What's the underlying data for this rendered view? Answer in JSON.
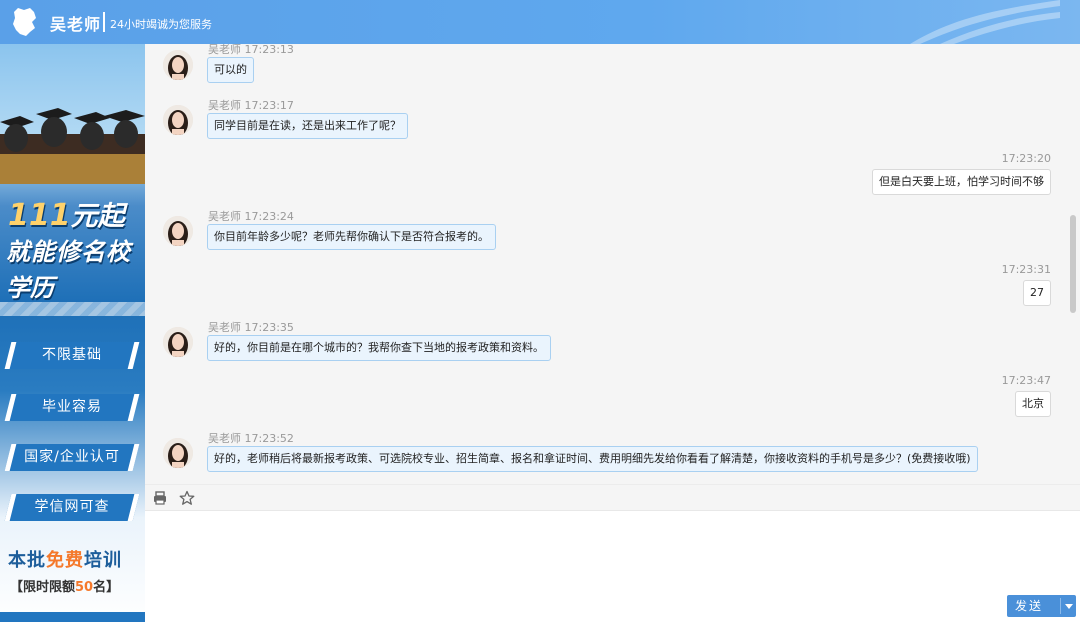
{
  "header": {
    "name": "吴老师",
    "slogan": "24小时竭诚为您服务",
    "color": "#5aa0e8"
  },
  "banner": {
    "price_num": "111",
    "price_suffix": "元起",
    "line2": "就能修名校",
    "line3": "学历",
    "tags": [
      "不限基础",
      "毕业容易",
      "国家/企业认可",
      "学信网可查"
    ],
    "free_a": "本批",
    "free_hl": "免费",
    "free_b": "培训",
    "limit_a": "【限时限额",
    "limit_n": "50",
    "limit_b": "名】"
  },
  "messages": [
    {
      "from": "teacher",
      "meta": "吴老师 17:23:13",
      "text": "可以的"
    },
    {
      "from": "teacher",
      "meta": "吴老师 17:23:17",
      "text": "同学目前是在读，还是出来工作了呢？"
    },
    {
      "from": "me",
      "meta": "17:23:20",
      "text": "但是白天要上班，怕学习时间不够"
    },
    {
      "from": "teacher",
      "meta": "吴老师 17:23:24",
      "text": "你目前年龄多少呢？老师先帮你确认下是否符合报考的。"
    },
    {
      "from": "me",
      "meta": "17:23:31",
      "text": "27"
    },
    {
      "from": "teacher",
      "meta": "吴老师 17:23:35",
      "text": "好的，你目前是在哪个城市的？我帮你查下当地的报考政策和资料。"
    },
    {
      "from": "me",
      "meta": "17:23:47",
      "text": "北京"
    },
    {
      "from": "teacher",
      "meta": "吴老师 17:23:52",
      "text": "好的，老师稍后将最新报考政策、可选院校专业、招生简章、报名和拿证时间、费用明细先发给你看看了解清楚，你接收资料的手机号是多少？(免费接收哦)"
    }
  ],
  "toolbar": {
    "icons": [
      "printer-icon",
      "star-icon"
    ]
  },
  "input": {
    "value": "",
    "send_label": "发送"
  }
}
